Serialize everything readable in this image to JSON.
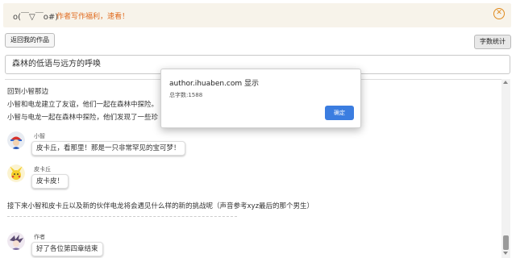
{
  "banner": {
    "face": "o(￣▽￣o#)",
    "message": "作者写作福利，速看！",
    "close_icon": "close-circle-icon"
  },
  "toolbar": {
    "back_label": "返回我的作品",
    "count_label": "字数统计"
  },
  "title_field": {
    "value": "森林的低语与远方的呼唤"
  },
  "content": {
    "lines": [
      "回到小智那边",
      "小智和电龙建立了友谊，他们一起在森林中探险。",
      "小智与电龙一起在森林中探险，他们发现了一些珍"
    ],
    "messages": [
      {
        "name": "小智",
        "text": "皮卡丘，看那里！那是一只非常罕见的宝可梦！"
      },
      {
        "name": "皮卡丘",
        "text": "皮卡皮！"
      }
    ],
    "narration": "接下来小智和皮卡丘以及新的伙伴电龙将会遇见什么样的新的挑战呢（声音参考xyz最后的那个男生）",
    "author_message": {
      "name": "作者",
      "text": "好了各位第四章结束"
    }
  },
  "dialog": {
    "title": "author.ihuaben.com 显示",
    "message": "总字数:1588",
    "ok_label": "确定"
  },
  "colors": {
    "banner_bg": "#f7f3ea",
    "banner_accent": "#e06b1f",
    "ok_button": "#3b7de0"
  }
}
